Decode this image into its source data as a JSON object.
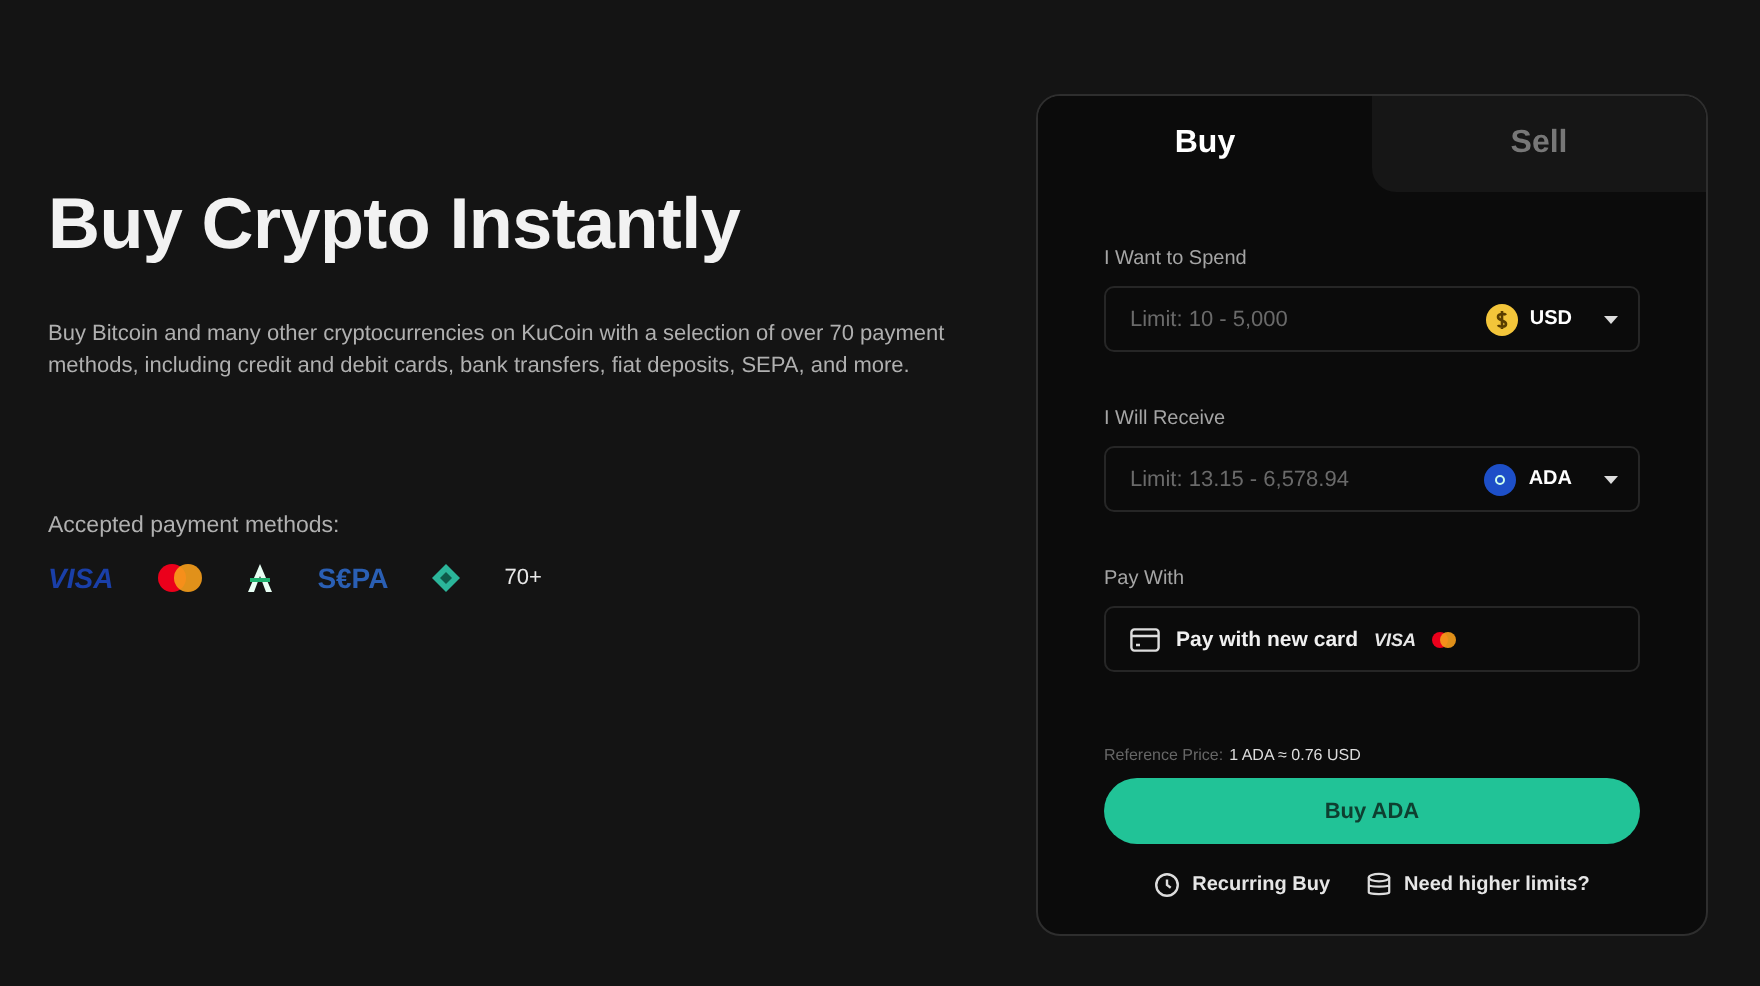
{
  "hero": {
    "title": "Buy Crypto Instantly",
    "description": "Buy Bitcoin and many other cryptocurrencies on KuCoin with a selection of over 70 payment methods, including credit and debit cards, bank transfers, fiat deposits, SEPA, and more."
  },
  "payment_methods": {
    "label": "Accepted payment methods:",
    "items": [
      {
        "kind": "visa",
        "label": "VISA"
      },
      {
        "kind": "mastercard"
      },
      {
        "kind": "arrow"
      },
      {
        "kind": "sepa",
        "label": "S€PA"
      },
      {
        "kind": "diamond"
      },
      {
        "kind": "more",
        "label": "70+"
      }
    ]
  },
  "trade_card": {
    "tabs": [
      {
        "label": "Buy",
        "selected": true
      },
      {
        "label": "Sell",
        "selected": false
      }
    ],
    "fields": [
      {
        "label": "I Want to Spend",
        "placeholder": "Limit: 10 - 5,000",
        "currency": "USD",
        "kind": "usd"
      },
      {
        "label": "I Will Receive",
        "placeholder": "Limit: 13.15 - 6,578.94",
        "currency": "ADA",
        "kind": "ada"
      }
    ],
    "pay_with": {
      "label": "Pay With",
      "option": "Pay with new card",
      "card_brand": "VISA"
    },
    "reference_price": {
      "label": "Reference Price:",
      "value": "1 ADA ≈ 0.76 USD"
    },
    "buy_button": "Buy ADA",
    "links": [
      {
        "kind": "recurring",
        "label": "Recurring Buy"
      },
      {
        "kind": "limits",
        "label": "Need higher limits?"
      }
    ]
  }
}
